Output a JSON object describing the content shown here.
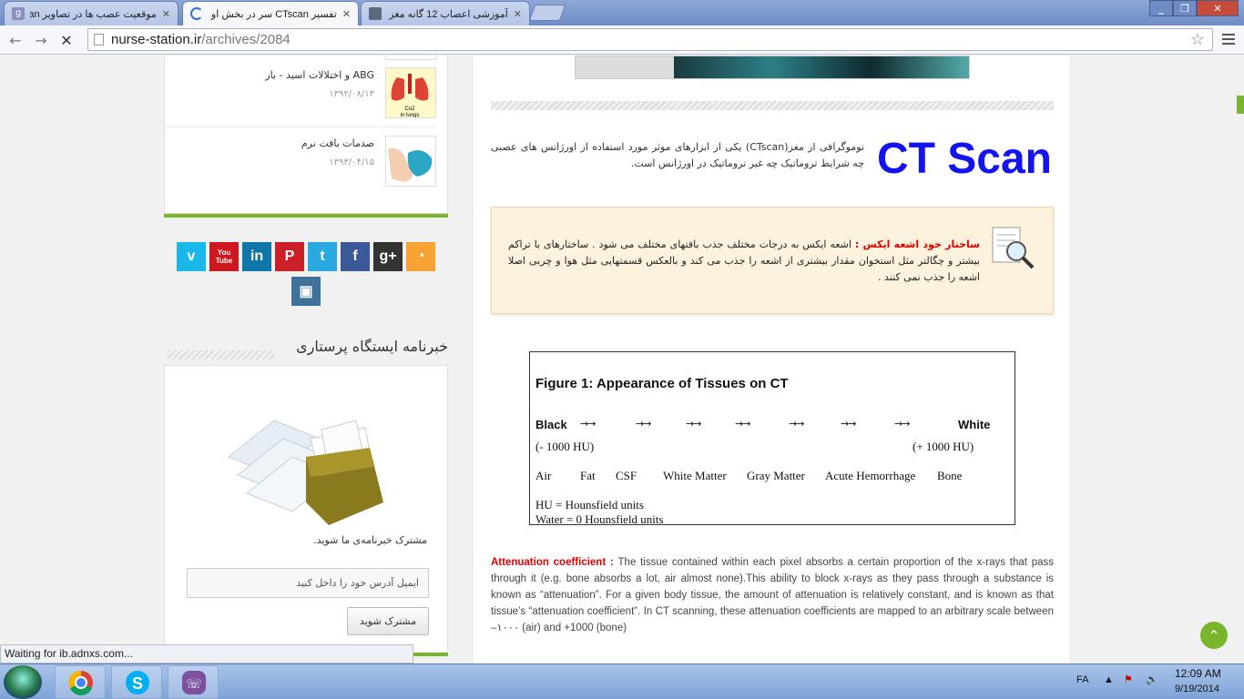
{
  "browser": {
    "tabs": [
      {
        "title": "موقعیت عصب ها در تصاویر an",
        "active": false
      },
      {
        "title": "تفسیر CTscan سر در بخش او",
        "active": true
      },
      {
        "title": "آموزشی اعصاب 12 گانه مغز",
        "active": false
      }
    ],
    "url_host": "nurse-station.ir",
    "url_path": "/archives/2084",
    "status_text": "Waiting for ib.adnxs.com..."
  },
  "sidebar": {
    "posts": [
      {
        "title": "ABG و اختلالات اسید - باز",
        "date": "۱۳۹۲/۰۸/۱۳",
        "thumb_label": "Co2 in lungs"
      },
      {
        "title": "صدمات بافت نرم",
        "date": "۱۳۹۳/۰۴/۱۵"
      }
    ],
    "social_icons": [
      "vimeo-icon",
      "youtube-icon",
      "linkedin-icon",
      "pinterest-icon",
      "twitter-icon",
      "facebook-icon",
      "googleplus-icon",
      "rss-icon",
      "instagram-icon"
    ],
    "social_glyphs": [
      "v",
      "You\nTube",
      "in",
      "P",
      "t",
      "f",
      "g+",
      "◔",
      "▣"
    ],
    "social_colors": [
      "#1ab7ea",
      "#cc181e",
      "#0e76a8",
      "#cb2027",
      "#2aa9e0",
      "#3b5998",
      "#333333",
      "#f7a234",
      "#3f729b"
    ],
    "newsletter": {
      "title": "خبرنامه ایستگاه پرستاری",
      "text": "مشترک خبرنامه‌ی ما شوید.",
      "placeholder": "ایمیل آدرس خود را داخل کنید",
      "button": "مشترک شوید"
    }
  },
  "article": {
    "heading": "CT Scan",
    "intro": "توموگرافی از مغز(CTscan) یکی از ابزارهای موثر مورد استفاده از اورژانس های عصبی چه شرایط تروماتیک چه غیر تروماتیک در اورژانس است.",
    "notice_key": "ساختار خود اشعه ایکس :",
    "notice_text": " اشعه ایکس به درجات مختلف جذب بافتهای مختلف می شود . ساختارهای با تراکم بیشتر و چگالتر مثل استخوان مقدار بیشتری از اشعه را جذب می کند و بالعکس قسمتهایی مثل هوا و چربی اصلا اشعه را جذب نمی کنند .",
    "figure": {
      "title": "Figure 1:  Appearance of Tissues on CT",
      "black": "Black",
      "white": "White",
      "arrow": "→→",
      "black_hu": "(- 1000 HU)",
      "white_hu": "(+ 1000 HU)",
      "tissues": [
        "Air",
        "Fat",
        "CSF",
        "White Matter",
        "Gray Matter",
        "Acute Hemorrhage",
        "Bone"
      ],
      "note1": "HU = Hounsfield units",
      "note2": "Water = 0 Hounsfield units"
    },
    "atten_key": "Attenuation coefficient : ",
    "atten_text": "The tissue contained within each pixel absorbs a certain proportion of the x-rays that pass through it (e.g. bone absorbs a lot, air almost none).This ability to block x-rays as they pass through a substance is known as “attenuation”. For a given body tissue, the amount of attenuation is relatively constant, and is known as that tissue’s “attenuation coefficient”. In CT scanning, these attenuation coefficients are mapped to an arbitrary scale between –۱۰۰۰ (air) and +1000 (bone)"
  },
  "taskbar": {
    "lang": "FA",
    "time": "12:09 AM",
    "date": "9/19/2014"
  },
  "colors": {
    "accent_green": "#7ab62c",
    "title_blue": "#1414f0",
    "key_red": "#e00000"
  }
}
